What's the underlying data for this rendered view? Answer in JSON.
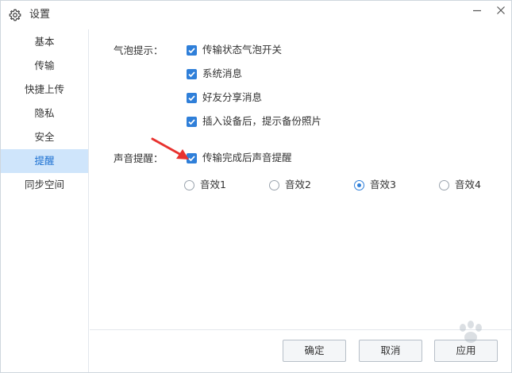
{
  "window": {
    "title": "设置",
    "icon": "gear-icon"
  },
  "sidebar": {
    "items": [
      {
        "label": "基本",
        "active": false
      },
      {
        "label": "传输",
        "active": false
      },
      {
        "label": "快捷上传",
        "active": false
      },
      {
        "label": "隐私",
        "active": false
      },
      {
        "label": "安全",
        "active": false
      },
      {
        "label": "提醒",
        "active": true
      },
      {
        "label": "同步空间",
        "active": false
      }
    ]
  },
  "bubble": {
    "label": "气泡提示：",
    "options": [
      {
        "label": "传输状态气泡开关",
        "checked": true
      },
      {
        "label": "系统消息",
        "checked": true
      },
      {
        "label": "好友分享消息",
        "checked": true
      },
      {
        "label": "插入设备后，提示备份照片",
        "checked": true
      }
    ]
  },
  "sound": {
    "label": "声音提醒：",
    "checkbox": {
      "label": "传输完成后声音提醒",
      "checked": true
    },
    "radios": [
      {
        "label": "音效1",
        "checked": false
      },
      {
        "label": "音效2",
        "checked": false
      },
      {
        "label": "音效3",
        "checked": true
      },
      {
        "label": "音效4",
        "checked": false
      }
    ]
  },
  "buttons": {
    "ok": "确定",
    "cancel": "取消",
    "apply": "应用"
  },
  "colors": {
    "accent": "#2f7fd9",
    "active_bg": "#cfe5fb",
    "annotation_arrow": "#e8322f"
  }
}
